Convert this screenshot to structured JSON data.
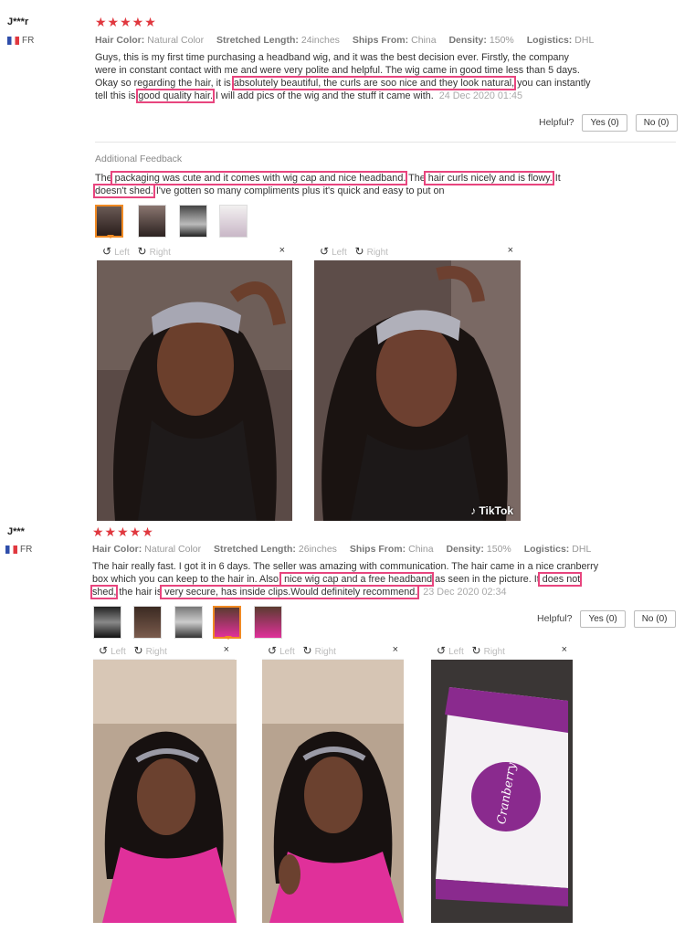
{
  "reviews": [
    {
      "reviewer": "J***r",
      "country": "FR",
      "stars": "★★★★★",
      "meta": [
        {
          "label": "Hair Color:",
          "value": "Natural Color"
        },
        {
          "label": "Stretched Length:",
          "value": "24inches"
        },
        {
          "label": "Ships From:",
          "value": "China"
        },
        {
          "label": "Density:",
          "value": "150%"
        },
        {
          "label": "Logistics:",
          "value": "DHL"
        }
      ],
      "text": {
        "p1": "Guys, this is my first time purchasing a headband wig, and it was the best decision ever. Firstly, the company were in constant contact with me and were very polite and helpful. The wig came in good time less than 5 days. Okay so regarding the hair, it is ",
        "h1": "absolutely beautiful, the curls are soo nice and they look natural,",
        "p2": " you can instantly tell this is ",
        "h2": "good quality hair.",
        "p3": " I will add pics of the wig and the stuff it came with."
      },
      "date": "24 Dec 2020 01:45",
      "helpful_label": "Helpful?",
      "yes_label": "Yes (0)",
      "no_label": "No (0)",
      "additional": {
        "label": "Additional Feedback",
        "p1": "The",
        "h1": " packaging was cute and it comes with wig cap and nice headband.",
        "p2": " The",
        "h2": " hair curls nicely and is flowy.",
        "p3": " It",
        "h3": "doesn't shed.",
        "p4": " I've gotten so many compliments plus it's quick and easy to put on"
      },
      "viewer": {
        "left": "Left",
        "right": "Right",
        "close": "×"
      },
      "watermark": "♪ TikTok"
    },
    {
      "reviewer": "J***",
      "country": "FR",
      "stars": "★★★★★",
      "meta": [
        {
          "label": "Hair Color:",
          "value": "Natural Color"
        },
        {
          "label": "Stretched Length:",
          "value": "26inches"
        },
        {
          "label": "Ships From:",
          "value": "China"
        },
        {
          "label": "Density:",
          "value": "150%"
        },
        {
          "label": "Logistics:",
          "value": "DHL"
        }
      ],
      "text": {
        "p1": "The hair really fast. I got it in 6 days. The seller was amazing with communication. The hair came in a nice cranberry box which you can keep to the hair in. Also,",
        "h1": " nice wig cap and a free headband",
        "p2": " as seen in the picture. It",
        "h2": " does not shed,",
        "p3": " the hair is",
        "h3": " very secure, has inside clips.Would definitely recommend.",
        "p4": ""
      },
      "date": "23 Dec 2020 02:34",
      "helpful_label": "Helpful?",
      "yes_label": "Yes (0)",
      "no_label": "No (0)",
      "viewer": {
        "left": "Left",
        "right": "Right",
        "close": "×"
      },
      "box_brand": "Cranberry"
    }
  ],
  "colors": {
    "star": "#e0383f",
    "highlight": "#e8457e",
    "active_thumb": "#f08a24",
    "shirt": "#e0309a"
  }
}
